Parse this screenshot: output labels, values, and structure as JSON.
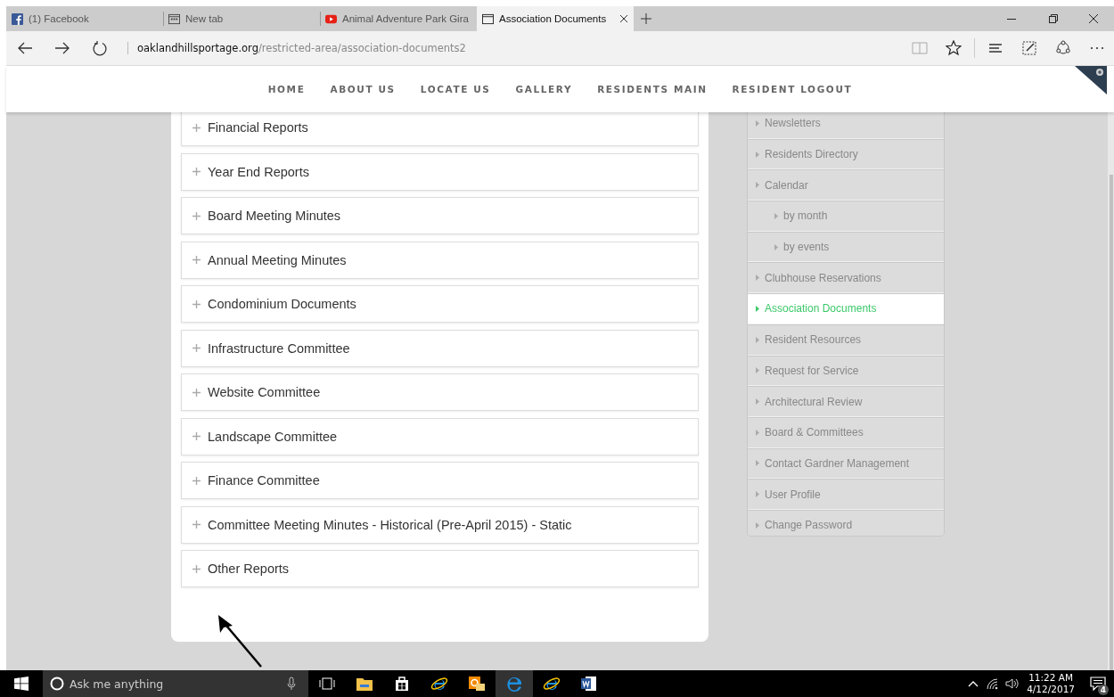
{
  "browser_tabs": [
    {
      "title": "(1) Facebook",
      "kind": "facebook",
      "selected": false
    },
    {
      "title": "New tab",
      "kind": "newtab",
      "selected": false
    },
    {
      "title": "Animal Adventure Park Gira",
      "kind": "video",
      "selected": false
    },
    {
      "title": "Association Documents",
      "kind": "page",
      "selected": true
    }
  ],
  "address_bar": {
    "domain": "oaklandhillsportage.org",
    "path": "/restricted-area/association-documents2"
  },
  "nav_menu": [
    "HOME",
    "ABOUT US",
    "LOCATE US",
    "GALLERY",
    "RESIDENTS MAIN",
    "RESIDENT LOGOUT"
  ],
  "document_sections": [
    {
      "title": "Financial Reports",
      "expanded": false
    },
    {
      "title": "Year End Reports",
      "expanded": false
    },
    {
      "title": "Board Meeting Minutes",
      "expanded": false
    },
    {
      "title": "Annual Meeting Minutes",
      "expanded": false
    },
    {
      "title": "Condominium Documents",
      "expanded": false
    },
    {
      "title": "Infrastructure Committee",
      "expanded": false
    },
    {
      "title": "Website Committee",
      "expanded": false
    },
    {
      "title": "Landscape Committee",
      "expanded": false
    },
    {
      "title": "Finance Committee",
      "expanded": false
    },
    {
      "title": "Committee Meeting Minutes - Historical (Pre-April 2015) - Static",
      "expanded": false
    },
    {
      "title": "Other Reports",
      "expanded": false
    }
  ],
  "sidebar": {
    "items": [
      {
        "label": "Newsletters",
        "selected": false
      },
      {
        "label": "Residents Directory",
        "selected": false
      },
      {
        "label": "Calendar",
        "selected": false,
        "children": [
          {
            "label": "by month",
            "selected": false
          },
          {
            "label": "by events",
            "selected": false
          }
        ]
      },
      {
        "label": "Clubhouse Reservations",
        "selected": false
      },
      {
        "label": "Association Documents",
        "selected": true
      },
      {
        "label": "Resident Resources",
        "selected": false
      },
      {
        "label": "Request for Service",
        "selected": false
      },
      {
        "label": "Architectural Review",
        "selected": false
      },
      {
        "label": "Board & Committees",
        "selected": false
      },
      {
        "label": "Contact Gardner Management",
        "selected": false
      },
      {
        "label": "User Profile",
        "selected": false
      },
      {
        "label": "Change Password",
        "selected": false
      }
    ]
  },
  "taskbar": {
    "search_placeholder": "Ask me anything",
    "time": "11:22 AM",
    "date": "4/12/2017",
    "notification_count": "4"
  }
}
